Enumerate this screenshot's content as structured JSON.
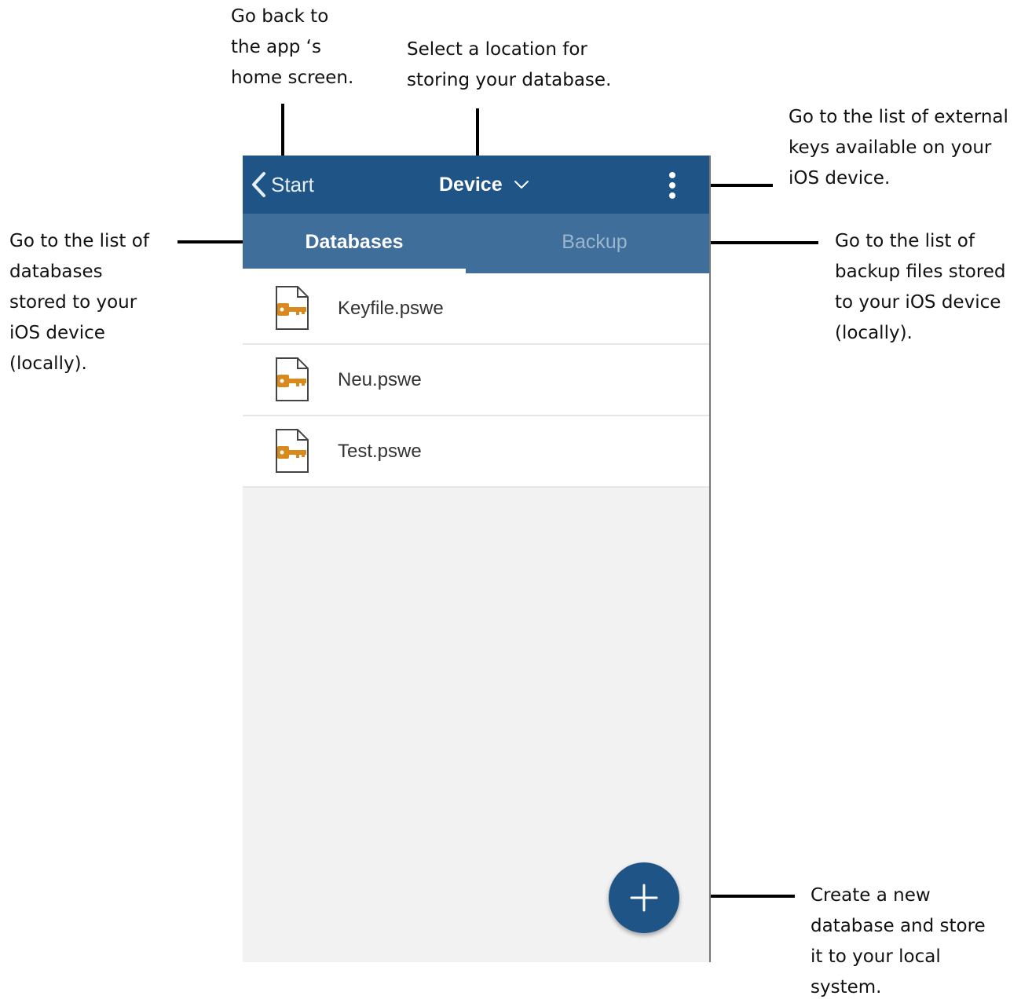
{
  "annotations": {
    "home": "Go back to\nthe app ‘s\nhome screen.",
    "location": "Select a location for\nstoring your database.",
    "keys": "Go to the list of external\nkeys available on your\niOS device.",
    "databases": "Go to the list of\ndatabases\nstored to your\niOS device\n(locally).",
    "backup": "Go to the list of\nbackup files stored\nto your iOS device\n(locally).",
    "create": "Create a new\ndatabase and store\nit to your local\nsystem."
  },
  "navbar": {
    "back_label": "Start",
    "location_label": "Device",
    "icons": [
      "chevron-left-icon",
      "chevron-down-icon",
      "more-vertical-icon"
    ]
  },
  "tabs": [
    {
      "label": "Databases",
      "active": true
    },
    {
      "label": "Backup",
      "active": false
    }
  ],
  "files": [
    {
      "name": "Keyfile.pswe",
      "icon": "key-file-icon"
    },
    {
      "name": "Neu.pswe",
      "icon": "key-file-icon"
    },
    {
      "name": "Test.pswe",
      "icon": "key-file-icon"
    }
  ],
  "fab": {
    "icon": "plus-icon"
  },
  "colors": {
    "navbar": "#1f5486",
    "tabbar": "#3e6e99",
    "inactive_tab": "#9bb5cf",
    "key_icon": "#d98a1e",
    "list_background": "#f2f2f2"
  }
}
